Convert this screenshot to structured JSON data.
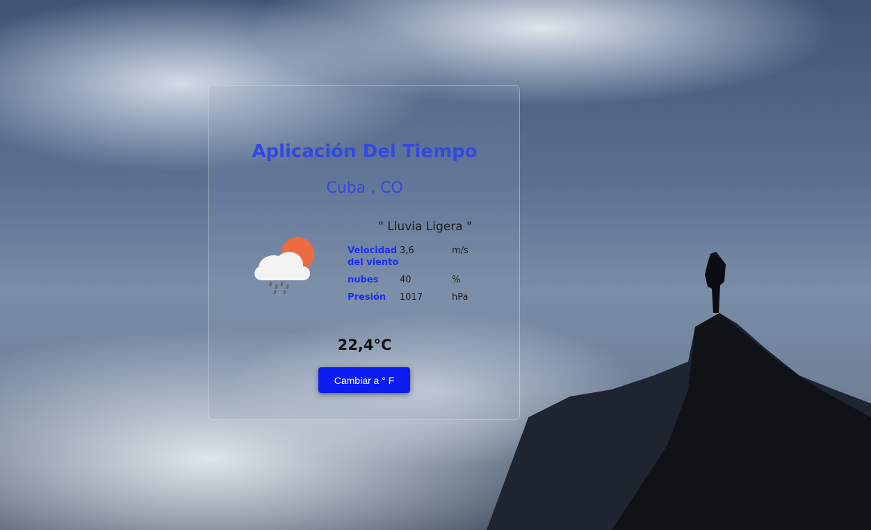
{
  "app": {
    "title": "Aplicación Del Tiempo",
    "location": "Cuba , CO"
  },
  "weather": {
    "description": "\" Lluvia Ligera \"",
    "icon": "cloud-sun-rain-icon",
    "details": [
      {
        "label": "Velocidad del viento",
        "value": "3,6",
        "unit": "m/s"
      },
      {
        "label": "nubes",
        "value": "40",
        "unit": "%"
      },
      {
        "label": "Presión",
        "value": "1017",
        "unit": "hPa"
      }
    ],
    "temperature": "22,4°C"
  },
  "controls": {
    "toggle_label": "Cambiar a ° F"
  },
  "colors": {
    "accent": "#3347e4",
    "label": "#1a2ff5",
    "button": "#0a1cf0"
  }
}
